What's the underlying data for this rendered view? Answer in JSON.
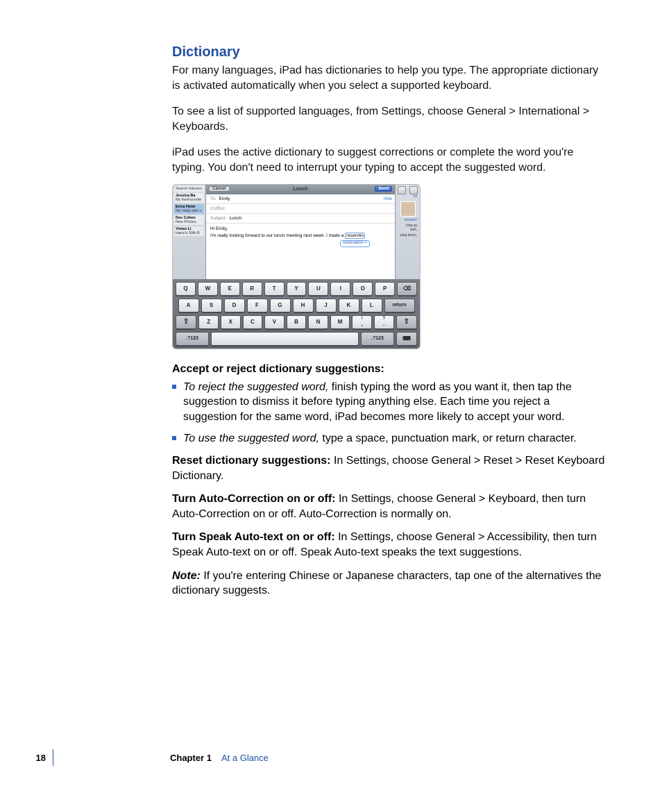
{
  "heading": "Dictionary",
  "intro": {
    "p1": "For many languages, iPad has dictionaries to help you type. The appropriate dictionary is activated automatically when you select a supported keyboard.",
    "p2": "To see a list of supported languages, from Settings, choose General > International > Keyboards.",
    "p3": "iPad uses the active dictionary to suggest corrections or complete the word you're typing. You don't need to interrupt your typing to accept the suggested word."
  },
  "screenshot": {
    "cancel": "Cancel",
    "title": "Lunch",
    "send": "Send",
    "hide": "Hide",
    "to_label": "To:",
    "to_value": "Emily",
    "cc_label": "Cc/Bcc:",
    "subject_label": "Subject:",
    "subject_value": "Lunch",
    "body_line1": "Hi Emily,",
    "body_line2_pre": "I'm really looking forward to our lunch meeting next week. I made a ",
    "typed_partial": "reservtio",
    "suggestion": "reservation ×",
    "sidebar": {
      "search": "Search Inboxes",
      "items": [
        {
          "name": "Jessica Ba",
          "sub": "My fiveFavorite"
        },
        {
          "name": "Erica Heim",
          "sub": "Re: Help with s"
        },
        {
          "name": "Des Cohen",
          "sub": "New Photos"
        },
        {
          "name": "Vivian Li",
          "sub": "Harry's 30th B"
        }
      ]
    },
    "right": {
      "line1": "smarter!",
      "line2": "king as well.",
      "line3": "ping down."
    },
    "keyboard": {
      "row1": [
        "Q",
        "W",
        "E",
        "R",
        "T",
        "Y",
        "U",
        "I",
        "O",
        "P"
      ],
      "row2": [
        "A",
        "S",
        "D",
        "F",
        "G",
        "H",
        "J",
        "K",
        "L"
      ],
      "row3": [
        "Z",
        "X",
        "C",
        "V",
        "B",
        "N",
        "M",
        "!",
        ",",
        "?",
        "."
      ],
      "return": "return",
      "sym": ".?123"
    }
  },
  "subhead": "Accept or reject dictionary suggestions:",
  "bullets": {
    "b1_lead": "To reject the suggested word,",
    "b1_rest": " finish typing the word as you want it, then tap the suggestion to dismiss it before typing anything else. Each time you reject a suggestion for the same word, iPad becomes more likely to accept your word.",
    "b2_lead": "To use the suggested word,",
    "b2_rest": " type a space, punctuation mark, or return character."
  },
  "tasks": {
    "reset_lead": "Reset dictionary suggestions:  ",
    "reset_rest": "In Settings, choose General > Reset > Reset Keyboard Dictionary.",
    "auto_lead": "Turn Auto-Correction on or off:  ",
    "auto_rest": "In Settings, choose General > Keyboard, then turn Auto-Correction on or off. Auto-Correction is normally on.",
    "speak_lead": "Turn Speak Auto-text on or off:  ",
    "speak_rest": "In Settings, choose General > Accessibility, then turn Speak Auto-text on or off. Speak Auto-text speaks the text suggestions."
  },
  "note": {
    "lead": "Note:  ",
    "rest": "If you're entering Chinese or Japanese characters, tap one of the alternatives the dictionary suggests."
  },
  "footer": {
    "page": "18",
    "chapter_label": "Chapter 1",
    "chapter_title": "At a Glance"
  }
}
